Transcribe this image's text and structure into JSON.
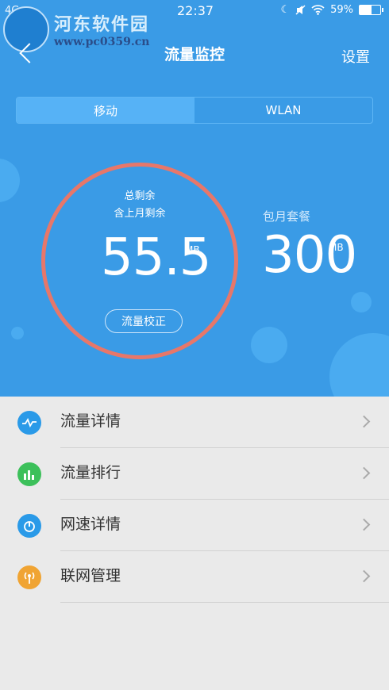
{
  "status_bar": {
    "carrier": "4G",
    "time": "22:37",
    "battery": "59%"
  },
  "watermark": {
    "title": "河东软件园",
    "url": "www.pc0359.cn"
  },
  "header": {
    "title": "流量监控",
    "settings_label": "设置"
  },
  "tabs": [
    {
      "label": "移动",
      "active": true
    },
    {
      "label": "WLAN",
      "active": false
    }
  ],
  "usage": {
    "remaining_label": "总剩余",
    "remaining_sub": "含上月剩余",
    "remaining_value": "55.5",
    "remaining_unit": "MB",
    "calibrate_label": "流量校正"
  },
  "plan": {
    "label": "包月套餐",
    "value": "300",
    "unit": "MB"
  },
  "colors": {
    "primary_blue": "#3a9be6",
    "ring": "#e7776a",
    "list_bg": "#eaeaea"
  },
  "menu": [
    {
      "label": "流量详情",
      "icon": "wave-icon",
      "color": "#2a9ae8"
    },
    {
      "label": "流量排行",
      "icon": "bar-chart-icon",
      "color": "#3cc05a"
    },
    {
      "label": "网速详情",
      "icon": "gauge-icon",
      "color": "#2a9ae8"
    },
    {
      "label": "联网管理",
      "icon": "antenna-icon",
      "color": "#f0a433"
    }
  ]
}
